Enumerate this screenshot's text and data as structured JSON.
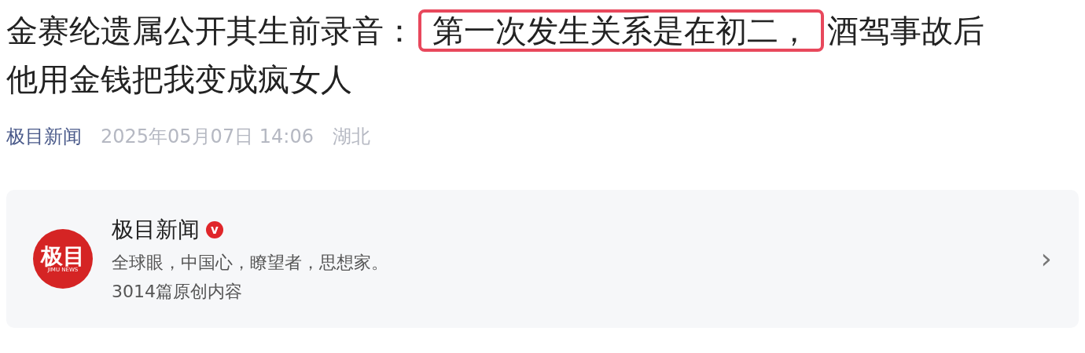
{
  "headline_lines": [
    [
      {
        "text": "金赛纶遗属公开其生前录音：",
        "highlighted": false
      },
      {
        "text": "第一次发生关系是在初二，",
        "highlighted": true
      },
      {
        "text": "酒驾事故后",
        "highlighted": false
      }
    ],
    [
      {
        "text": "他用金钱把我变成疯女人",
        "highlighted": false
      }
    ]
  ],
  "meta": {
    "source": "极目新闻",
    "datetime": "2025年05月07日 14:06",
    "location": "湖北"
  },
  "author_card": {
    "logo": {
      "text": "极目",
      "subtitle": "JIMU NEWS"
    },
    "name": "极目新闻",
    "verified": true,
    "verified_mark": "v",
    "motto": "全球眼，中国心，瞭望者，思想家。",
    "stats": "3014篇原创内容",
    "chevron": "›"
  }
}
